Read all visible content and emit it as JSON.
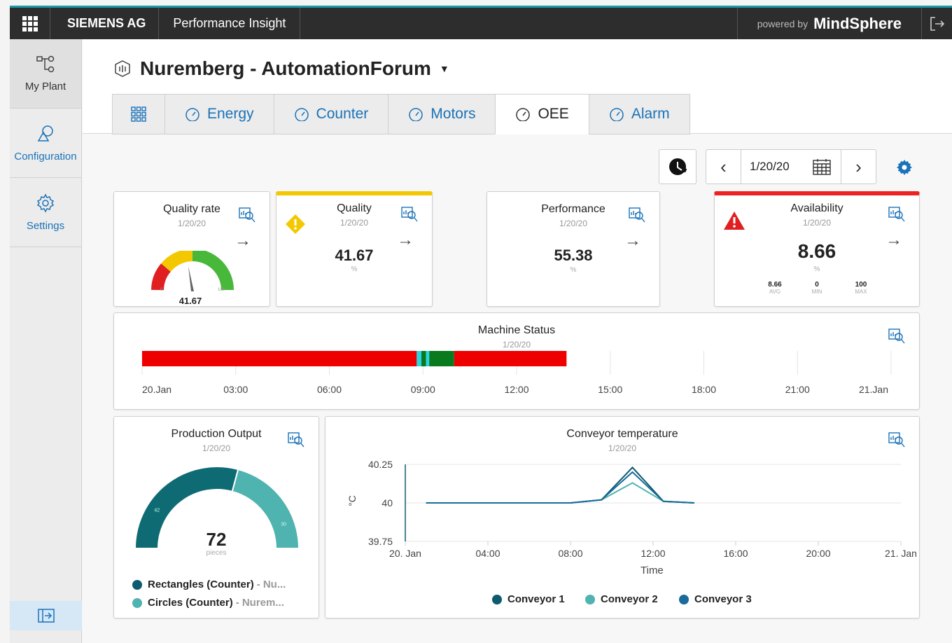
{
  "topbar": {
    "company": "SIEMENS AG",
    "app_name": "Performance Insight",
    "powered_prefix": "powered by",
    "powered_brand": "MindSphere"
  },
  "sidebar": {
    "items": [
      {
        "label": "My Plant"
      },
      {
        "label": "Configuration"
      },
      {
        "label": "Settings"
      }
    ]
  },
  "page": {
    "title": "Nuremberg - AutomationForum"
  },
  "tabs": [
    {
      "label": "Energy"
    },
    {
      "label": "Counter"
    },
    {
      "label": "Motors"
    },
    {
      "label": "OEE"
    },
    {
      "label": "Alarm"
    }
  ],
  "date_nav": {
    "date": "1/20/20"
  },
  "kpis": {
    "quality_rate": {
      "title": "Quality rate",
      "date": "1/20/20",
      "value": "41.67",
      "gauge_min": "0",
      "gauge_max": "100",
      "unit": "%"
    },
    "quality": {
      "title": "Quality",
      "date": "1/20/20",
      "value": "41.67",
      "unit": "%"
    },
    "performance": {
      "title": "Performance",
      "date": "1/20/20",
      "value": "55.38",
      "unit": "%"
    },
    "availability": {
      "title": "Availability",
      "date": "1/20/20",
      "value": "8.66",
      "unit": "%",
      "avg": "8.66",
      "avg_label": "AVG",
      "min": "0",
      "min_label": "MIN",
      "max": "100",
      "max_label": "MAX"
    }
  },
  "machine_status": {
    "title": "Machine Status",
    "date": "1/20/20",
    "ticks": [
      "20.Jan",
      "03:00",
      "06:00",
      "09:00",
      "12:00",
      "15:00",
      "18:00",
      "21:00",
      "21.Jan"
    ]
  },
  "production": {
    "title": "Production Output",
    "date": "1/20/20",
    "total": "72",
    "unit": "pieces",
    "seg1_value": "42",
    "seg2_value": "30",
    "legend": [
      {
        "name": "Rectangles (Counter)",
        "sub": "- Nu...",
        "color": "#0e6b74"
      },
      {
        "name": "Circles (Counter)",
        "sub": "- Nurem...",
        "color": "#4fb3b0"
      }
    ]
  },
  "conveyor": {
    "title": "Conveyor temperature",
    "date": "1/20/20",
    "ylabel": "°C",
    "xlabel": "Time",
    "legend": [
      {
        "name": "Conveyor 1",
        "color": "#0e5a6e"
      },
      {
        "name": "Conveyor 2",
        "color": "#4fb3b0"
      },
      {
        "name": "Conveyor 3",
        "color": "#1a6a9a"
      }
    ]
  },
  "chart_data": [
    {
      "type": "bar",
      "title": "Machine Status",
      "categories": [
        "20.Jan",
        "03:00",
        "06:00",
        "09:00",
        "12:00",
        "15:00",
        "18:00",
        "21:00",
        "21.Jan"
      ],
      "segments": [
        {
          "start_h": 0.0,
          "end_h": 8.8,
          "color": "#ee0000"
        },
        {
          "start_h": 8.8,
          "end_h": 8.95,
          "color": "#2ad4e0"
        },
        {
          "start_h": 8.95,
          "end_h": 9.1,
          "color": "#0a7a1e"
        },
        {
          "start_h": 9.1,
          "end_h": 9.2,
          "color": "#2ad4e0"
        },
        {
          "start_h": 9.2,
          "end_h": 10.0,
          "color": "#0a7a1e"
        },
        {
          "start_h": 10.0,
          "end_h": 13.6,
          "color": "#ee0000"
        }
      ]
    },
    {
      "type": "pie",
      "title": "Production Output",
      "categories": [
        "Rectangles (Counter)",
        "Circles (Counter)"
      ],
      "values": [
        42,
        30
      ]
    },
    {
      "type": "line",
      "title": "Conveyor temperature",
      "xlabel": "Time",
      "ylabel": "°C",
      "x": [
        "01:00",
        "04:00",
        "08:00",
        "09:30",
        "11:00",
        "12:30",
        "14:00"
      ],
      "x_ticks": [
        "20. Jan",
        "04:00",
        "08:00",
        "12:00",
        "16:00",
        "20:00",
        "21. Jan"
      ],
      "y_ticks": [
        "39.75",
        "40",
        "40.25"
      ],
      "ylim": [
        39.75,
        40.25
      ],
      "series": [
        {
          "name": "Conveyor 1",
          "values": [
            40,
            40,
            40,
            40.02,
            40.23,
            40.01,
            40.0
          ]
        },
        {
          "name": "Conveyor 2",
          "values": [
            40,
            40,
            40,
            40.02,
            40.13,
            40.01,
            40.0
          ]
        },
        {
          "name": "Conveyor 3",
          "values": [
            40,
            40,
            40,
            40.02,
            40.2,
            40.01,
            40.0
          ]
        }
      ]
    }
  ]
}
